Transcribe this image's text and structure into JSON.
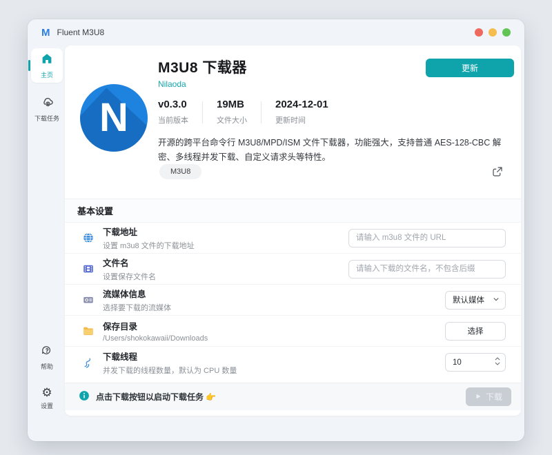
{
  "titlebar": {
    "app_name": "Fluent M3U8",
    "logo_letter": "M"
  },
  "colors": {
    "accent_teal": "#0fa3ab",
    "logo_blue": "#1e83de",
    "traffic_red": "#ee6a5f",
    "traffic_yellow": "#f5bd4f",
    "traffic_green": "#61c455"
  },
  "sidebar": {
    "home": "主页",
    "tasks": "下载任务",
    "help": "帮助",
    "settings": "设置"
  },
  "header": {
    "title": "M3U8 下载器",
    "author": "Nilaoda",
    "logo_letter": "N",
    "update_button": "更新",
    "stats": [
      {
        "value": "v0.3.0",
        "label": "当前版本"
      },
      {
        "value": "19MB",
        "label": "文件大小"
      },
      {
        "value": "2024-12-01",
        "label": "更新时间"
      }
    ],
    "description": "开源的跨平台命令行 M3U8/MPD/ISM 文件下载器，功能强大，支持普通 AES-128-CBC 解密、多线程并发下载、自定义请求头等特性。",
    "tag": "M3U8"
  },
  "settings_section": {
    "title": "基本设置",
    "rows": [
      {
        "title": "下载地址",
        "subtitle": "设置 m3u8 文件的下载地址",
        "placeholder": "请输入 m3u8 文件的 URL"
      },
      {
        "title": "文件名",
        "subtitle": "设置保存文件名",
        "placeholder": "请输入下载的文件名，不包含后缀"
      },
      {
        "title": "流媒体信息",
        "subtitle": "选择要下载的流媒体",
        "value": "默认媒体"
      },
      {
        "title": "保存目录",
        "subtitle": "/Users/shokokawaii/Downloads",
        "button": "选择"
      },
      {
        "title": "下载线程",
        "subtitle": "并发下载的线程数量，默认为 CPU 数量",
        "value": "10"
      }
    ]
  },
  "footer": {
    "hint": "点击下载按钮以启动下载任务 👉",
    "download_button": "下载"
  }
}
